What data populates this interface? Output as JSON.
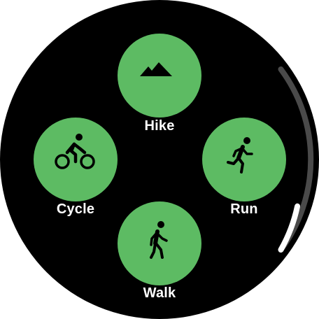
{
  "screen": {
    "background_color": "#000000",
    "accent_color": "#5DBB63",
    "icon_color": "#000000",
    "text_color": "#ffffff"
  },
  "activities": [
    {
      "id": "hike",
      "label": "Hike",
      "icon": "mountain-icon"
    },
    {
      "id": "cycle",
      "label": "Cycle",
      "icon": "bicycle-icon"
    },
    {
      "id": "run",
      "label": "Run",
      "icon": "running-person-icon"
    },
    {
      "id": "walk",
      "label": "Walk",
      "icon": "walking-person-icon"
    }
  ],
  "scroll_indicator": {
    "track_color": "#4a4a4a",
    "thumb_color": "#ffffff",
    "scroll_position": 0.5
  }
}
